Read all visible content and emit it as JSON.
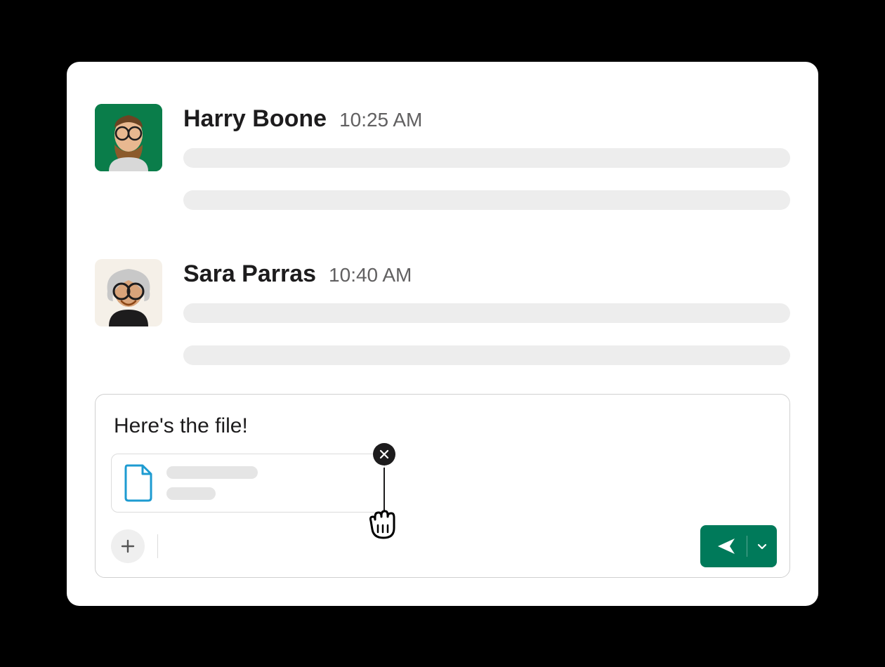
{
  "messages": [
    {
      "name": "Harry Boone",
      "time": "10:25 AM"
    },
    {
      "name": "Sara Parras",
      "time": "10:40 AM"
    }
  ],
  "composer": {
    "text": "Here's the file!"
  },
  "colors": {
    "send": "#007a5a",
    "fileIcon": "#1d9bd1"
  }
}
